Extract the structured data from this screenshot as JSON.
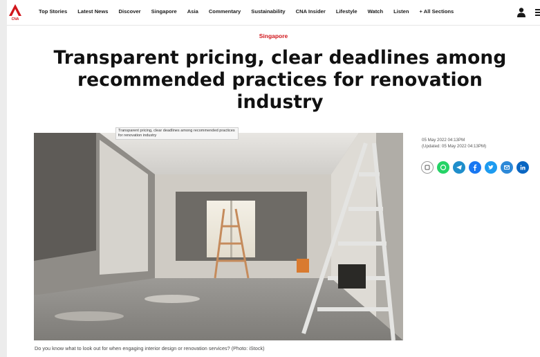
{
  "brand": {
    "logo_text": "CNA",
    "accent": "#d1161c"
  },
  "nav": {
    "items": [
      "Top Stories",
      "Latest News",
      "Discover",
      "Singapore",
      "Asia",
      "Commentary",
      "Sustainability",
      "CNA Insider",
      "Lifestyle",
      "Watch",
      "Listen",
      "+ All Sections"
    ],
    "icons": [
      "user-icon",
      "menu-icon"
    ]
  },
  "article": {
    "category": "Singapore",
    "headline": "Transparent pricing, clear deadlines among recommended practices for renovation industry",
    "image_tooltip": "Transparent pricing, clear deadlines among recommended practices for renovation industry",
    "caption": "Do you know what to look out for when engaging interior design or renovation services? (Photo: iStock)",
    "published": "05 May 2022 04:13PM",
    "updated": "(Updated: 05 May 2022 04:13PM)"
  },
  "share": {
    "buttons": [
      {
        "name": "copy-link-icon",
        "color": "#ffffff"
      },
      {
        "name": "whatsapp-icon",
        "color": "#25d366"
      },
      {
        "name": "telegram-icon",
        "color": "#1f8ecb"
      },
      {
        "name": "facebook-icon",
        "color": "#1877f2"
      },
      {
        "name": "twitter-icon",
        "color": "#1d9bf0"
      },
      {
        "name": "email-icon",
        "color": "#2d89d8"
      },
      {
        "name": "linkedin-icon",
        "color": "#0a66c2"
      }
    ]
  }
}
